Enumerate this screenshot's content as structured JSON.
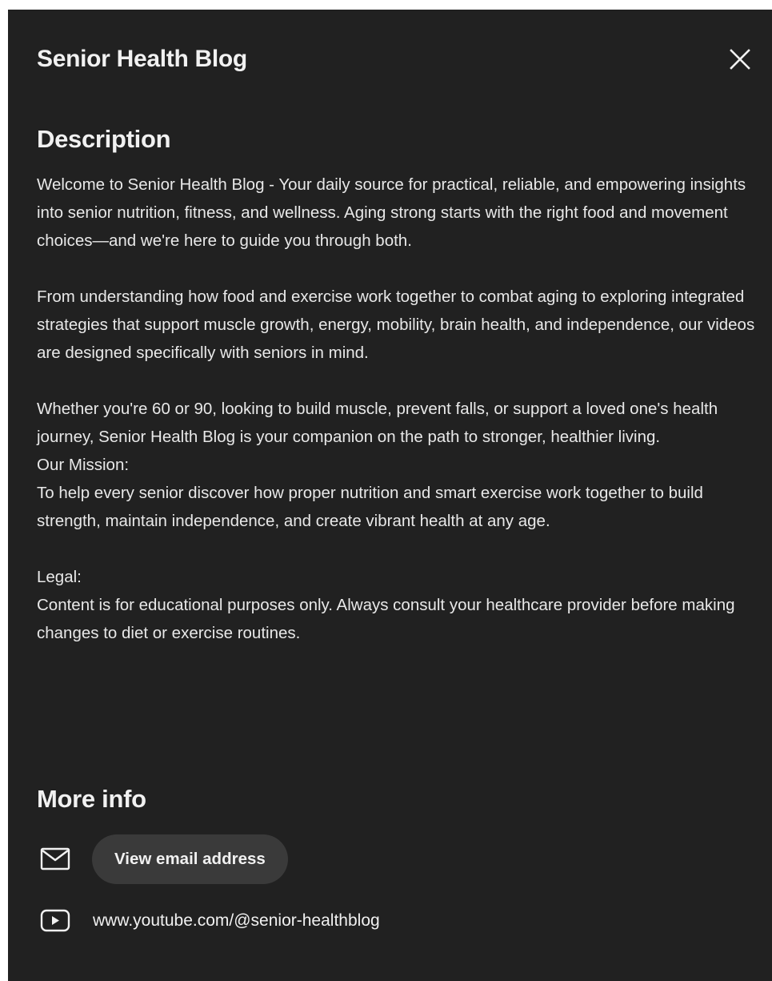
{
  "dialog": {
    "title": "Senior Health Blog",
    "close_icon": "close-icon"
  },
  "description": {
    "heading": "Description",
    "text": "Welcome to Senior Health Blog - Your daily source for practical, reliable, and empowering insights into senior nutrition, fitness, and wellness. Aging strong starts with the right food and movement choices—and we're here to guide you through both.\n\nFrom understanding how food and exercise work together to combat aging to exploring integrated strategies that support muscle growth, energy, mobility, brain health, and independence, our videos are designed specifically with seniors in mind.\n\nWhether you're 60 or 90, looking to build muscle, prevent falls, or support a loved one's health journey, Senior Health Blog is your companion on the path to stronger, healthier living.\nOur Mission:\nTo help every senior discover how proper nutrition and smart exercise work together to build strength, maintain independence, and create vibrant health at any age.\n\nLegal:\nContent is for educational purposes only. Always consult your healthcare provider before making changes to diet or exercise routines."
  },
  "more_info": {
    "heading": "More info",
    "email_icon": "mail-icon",
    "email_button_label": "View email address",
    "link_icon": "youtube-play-icon",
    "channel_url": "www.youtube.com/@senior-healthblog"
  },
  "colors": {
    "background": "#212121",
    "text": "#f1f1f1",
    "button": "#3a3a3a"
  }
}
